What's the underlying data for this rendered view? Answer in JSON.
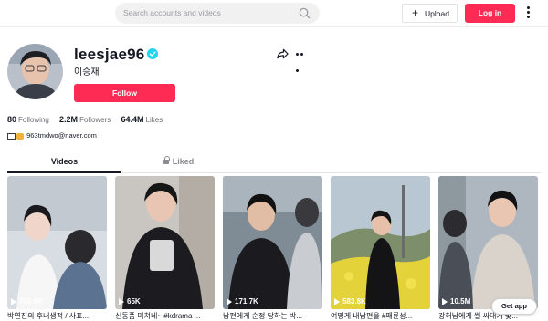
{
  "header": {
    "search_placeholder": "Search accounts and videos",
    "upload_label": "Upload",
    "login_label": "Log in"
  },
  "profile": {
    "username": "leesjae96",
    "nickname": "이승재",
    "follow_label": "Follow",
    "following_count": "80",
    "following_label": "Following",
    "followers_count": "2.2M",
    "followers_label": "Followers",
    "likes_count": "64.4M",
    "likes_label": "Likes",
    "bio": "963tmdwo@naver.com"
  },
  "tabs": {
    "videos": "Videos",
    "liked": "Liked"
  },
  "videos": [
    {
      "views": "702.6K",
      "caption": "박연진의 후내생적 / 사표..."
    },
    {
      "views": "65K",
      "caption": "신동품 미쳐네~ #kdrama ..."
    },
    {
      "views": "171.7K",
      "caption": "남편에게 순정 당하는 박..."
    },
    {
      "views": "583.8K",
      "caption": "여명게 내남편을 #패륜성..."
    },
    {
      "views": "10.5M",
      "caption": "강혀남에게 썰 싸대기 맞..."
    }
  ],
  "get_app_label": "Get app",
  "colors": {
    "accent": "#fe2c55",
    "verified": "#20d5ec",
    "text": "#161823"
  }
}
